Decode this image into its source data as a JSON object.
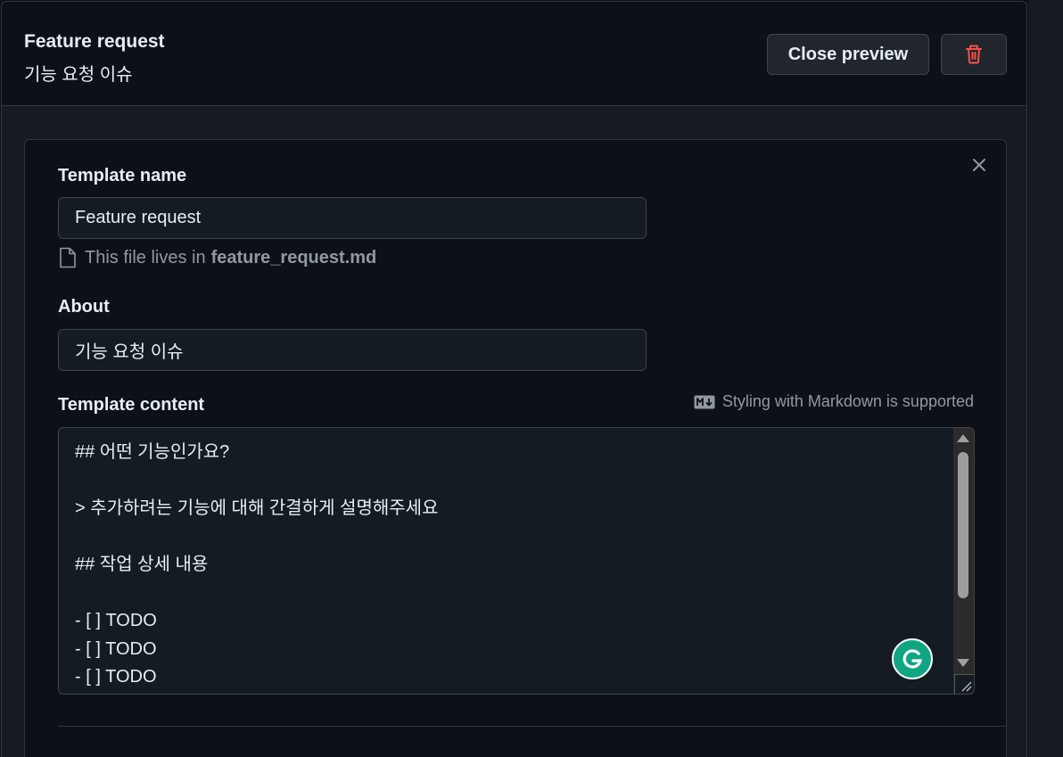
{
  "header": {
    "title": "Feature request",
    "subtitle": "기능 요청 이슈",
    "close_preview_label": "Close preview",
    "delete_icon": "trash-icon"
  },
  "form": {
    "template_name_label": "Template name",
    "template_name_value": "Feature request",
    "file_note_prefix": "This file lives in",
    "file_name": "feature_request.md",
    "about_label": "About",
    "about_value": "기능 요청 이슈",
    "content_label": "Template content",
    "markdown_note": "Styling with Markdown is supported",
    "content_value": "## 어떤 기능인가요?\n\n> 추가하려는 기능에 대해 간결하게 설명해주세요\n\n## 작업 상세 내용\n\n- [ ] TODO\n- [ ] TODO\n- [ ] TODO"
  },
  "colors": {
    "background": "#0d1117",
    "panel": "#161b22",
    "border": "#30363d",
    "danger": "#f85149",
    "grammarly": "#11a683"
  }
}
